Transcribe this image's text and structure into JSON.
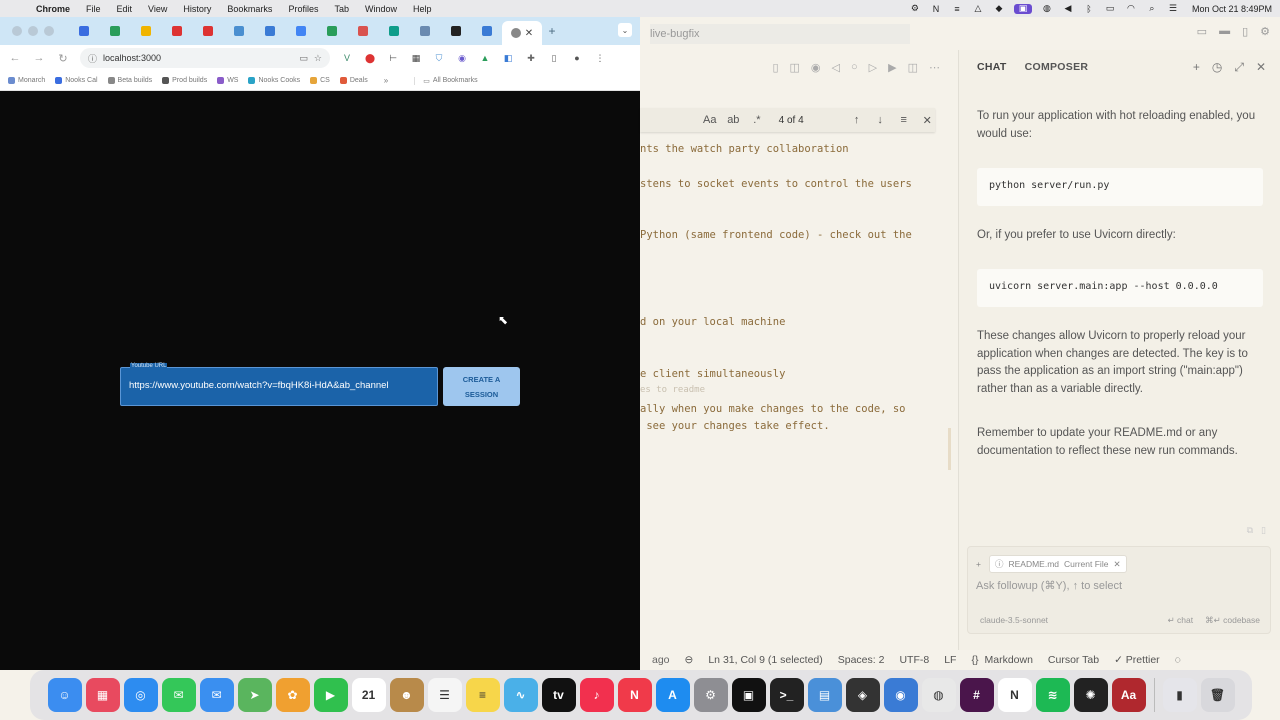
{
  "menubar": {
    "app": "Chrome",
    "items": [
      "File",
      "Edit",
      "View",
      "History",
      "Bookmarks",
      "Profiles",
      "Tab",
      "Window",
      "Help"
    ],
    "clock": "Mon Oct 21  8:49PM"
  },
  "browser": {
    "tab_count_icons": 16,
    "address": "localhost:3000",
    "bookmarks": [
      {
        "label": "Monarch",
        "color": "#6b8ccf"
      },
      {
        "label": "Nooks Cal",
        "color": "#3a6de0"
      },
      {
        "label": "Beta builds",
        "color": "#888888"
      },
      {
        "label": "Prod builds",
        "color": "#555555"
      },
      {
        "label": "WS",
        "color": "#8a5cc9"
      },
      {
        "label": "Nooks Cooks",
        "color": "#2aa3c7"
      },
      {
        "label": "CS",
        "color": "#e6a53a"
      },
      {
        "label": "Deals",
        "color": "#e05a3a"
      }
    ],
    "bookmarks_more": "»",
    "all_bookmarks": "All Bookmarks",
    "page": {
      "url_field_label": "Youtube URL",
      "url_field_value": "https://www.youtube.com/watch?v=fbqHK8i-HdA&ab_channel",
      "create_button": "CREATE A SESSION"
    }
  },
  "editor": {
    "project": "live-bugfix",
    "find": {
      "count": "4 of 4"
    },
    "code_lines": [
      {
        "text": "nts the watch party collaboration",
        "faint": false
      },
      {
        "text": "stens to socket events to control the users",
        "faint": false
      },
      {
        "text": "Python (same frontend code) - check out the",
        "faint": false
      },
      {
        "text": "d on your local machine",
        "faint": false
      },
      {
        "text": "e client simultaneously",
        "faint": false
      },
      {
        "text": "es to readme",
        "faint": true
      },
      {
        "text": "ally when you make changes to the code, so",
        "faint": false
      },
      {
        "text": " see your changes take effect.",
        "faint": false
      }
    ]
  },
  "chat": {
    "tab_chat": "CHAT",
    "tab_composer": "COMPOSER",
    "msg1": "To run your application with hot reloading enabled, you would use:",
    "code1": "python server/run.py",
    "msg2": "Or, if you prefer to use Uvicorn directly:",
    "code2": "uvicorn server.main:app --host 0.0.0.0",
    "msg3": "These changes allow Uvicorn to properly reload your application when changes are detected. The key is to pass the application as an import string (\"main:app\") rather than as a variable directly.",
    "msg4": "Remember to update your README.md or any documentation to reflect these new run commands.",
    "context_file": "README.md",
    "context_tag": "Current File",
    "input_placeholder": "Ask followup (⌘Y), ↑ to select",
    "model": "claude-3.5-sonnet",
    "shortcut_chat": "↵ chat",
    "shortcut_codebase": "⌘↵ codebase"
  },
  "statusbar": {
    "left": "ago",
    "position": "Ln 31, Col 9 (1 selected)",
    "spaces": "Spaces: 2",
    "encoding": "UTF-8",
    "eol": "LF",
    "language": "Markdown",
    "tab": "Cursor Tab",
    "prettier": "✓ Prettier"
  },
  "dock": [
    {
      "name": "Finder",
      "color": "#3b8df0",
      "glyph": "☺"
    },
    {
      "name": "Launchpad",
      "color": "#e84a5f",
      "glyph": "▦"
    },
    {
      "name": "Safari",
      "color": "#2d8cf0",
      "glyph": "◎"
    },
    {
      "name": "Messages",
      "color": "#34c759",
      "glyph": "✉"
    },
    {
      "name": "Mail",
      "color": "#3a8ff0",
      "glyph": "✉"
    },
    {
      "name": "Maps",
      "color": "#5ab55e",
      "glyph": "➤"
    },
    {
      "name": "Photos",
      "color": "#f0a030",
      "glyph": "✿"
    },
    {
      "name": "FaceTime",
      "color": "#30c04e",
      "glyph": "▶"
    },
    {
      "name": "Calendar",
      "color": "#ffffff",
      "glyph": "21"
    },
    {
      "name": "Contacts",
      "color": "#b88a4a",
      "glyph": "☻"
    },
    {
      "name": "Reminders",
      "color": "#f5f5f5",
      "glyph": "☰"
    },
    {
      "name": "Notes",
      "color": "#f7d64a",
      "glyph": "≡"
    },
    {
      "name": "Freeform",
      "color": "#4ab0e8",
      "glyph": "∿"
    },
    {
      "name": "TV",
      "color": "#111111",
      "glyph": "tv"
    },
    {
      "name": "Music",
      "color": "#f2304e",
      "glyph": "♪"
    },
    {
      "name": "News",
      "color": "#f03a4a",
      "glyph": "N"
    },
    {
      "name": "App Store",
      "color": "#1e8cf0",
      "glyph": "A"
    },
    {
      "name": "System Settings",
      "color": "#8e8e93",
      "glyph": "⚙"
    },
    {
      "name": "Cursor",
      "color": "#111111",
      "glyph": "▣"
    },
    {
      "name": "Terminal",
      "color": "#222222",
      "glyph": ">_"
    },
    {
      "name": "Preview",
      "color": "#4a90d9",
      "glyph": "▤"
    },
    {
      "name": "Nooks",
      "color": "#333333",
      "glyph": "◈"
    },
    {
      "name": "Proxyman",
      "color": "#3a7bd5",
      "glyph": "◉"
    },
    {
      "name": "Chrome",
      "color": "#e8e8e8",
      "glyph": "◍"
    },
    {
      "name": "Slack",
      "color": "#4a154b",
      "glyph": "#"
    },
    {
      "name": "Notion",
      "color": "#ffffff",
      "glyph": "N"
    },
    {
      "name": "Spotify",
      "color": "#1db954",
      "glyph": "≋"
    },
    {
      "name": "ChatGPT",
      "color": "#222222",
      "glyph": "✺"
    },
    {
      "name": "Dictionary",
      "color": "#b0282e",
      "glyph": "Aa"
    },
    {
      "name": "Downloads",
      "color": "#e5e5ea",
      "glyph": "▮"
    },
    {
      "name": "Trash",
      "color": "#d8d8dc",
      "glyph": "🗑"
    }
  ]
}
